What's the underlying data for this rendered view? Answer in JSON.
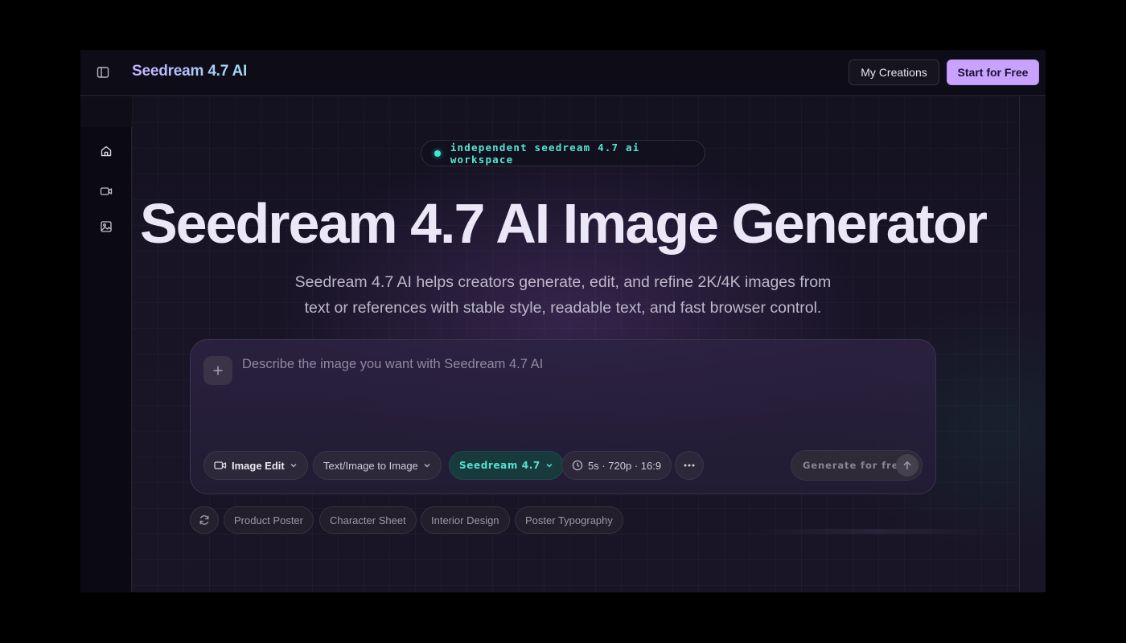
{
  "header": {
    "brand": "Seedream 4.7 AI",
    "my_creations_label": "My Creations",
    "start_label": "Start for Free"
  },
  "sidebar": {
    "items": [
      {
        "icon": "home-icon"
      },
      {
        "icon": "video-icon"
      },
      {
        "icon": "image-icon"
      }
    ]
  },
  "hero": {
    "badge": "independent seedream 4.7 ai workspace",
    "title": "Seedream 4.7 AI Image Generator",
    "subtitle": "Seedream 4.7 AI helps creators generate, edit, and refine 2K/4K images from text or references with stable style, readable text, and fast browser control."
  },
  "prompt": {
    "placeholder": "Describe the image you want with Seedream 4.7 AI",
    "value": "",
    "mode_label": "Image Edit",
    "type_label": "Text/Image to Image",
    "model_label": "Seedream 4.7",
    "settings_label": "5s · 720p · 16:9",
    "generate_label": "Generate for free"
  },
  "suggestions": [
    "Product Poster",
    "Character Sheet",
    "Interior Design",
    "Poster Typography"
  ],
  "colors": {
    "accent": "#c9a2ff",
    "teal": "#3ee6cf",
    "background": "#12101e"
  }
}
